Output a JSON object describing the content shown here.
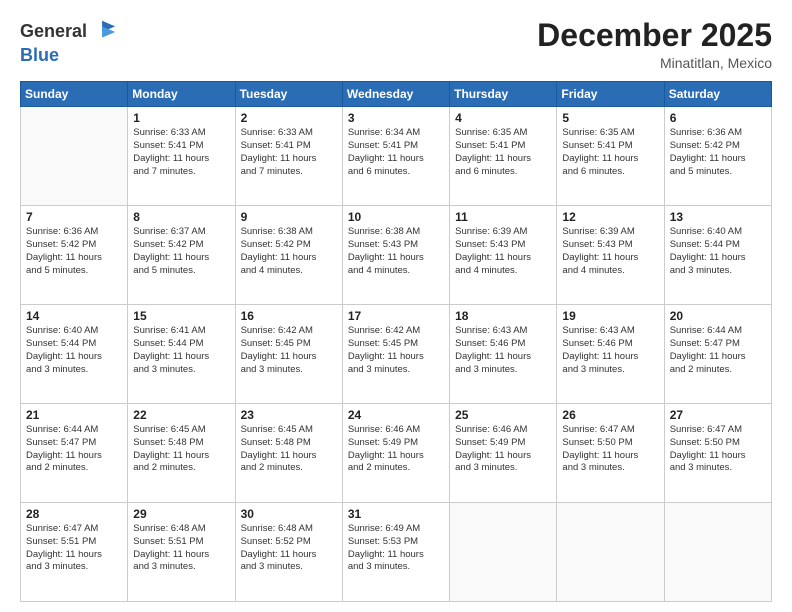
{
  "header": {
    "logo_line1": "General",
    "logo_line2": "Blue",
    "month": "December 2025",
    "location": "Minatitlan, Mexico"
  },
  "weekdays": [
    "Sunday",
    "Monday",
    "Tuesday",
    "Wednesday",
    "Thursday",
    "Friday",
    "Saturday"
  ],
  "weeks": [
    [
      {
        "day": "",
        "info": ""
      },
      {
        "day": "1",
        "info": "Sunrise: 6:33 AM\nSunset: 5:41 PM\nDaylight: 11 hours\nand 7 minutes."
      },
      {
        "day": "2",
        "info": "Sunrise: 6:33 AM\nSunset: 5:41 PM\nDaylight: 11 hours\nand 7 minutes."
      },
      {
        "day": "3",
        "info": "Sunrise: 6:34 AM\nSunset: 5:41 PM\nDaylight: 11 hours\nand 6 minutes."
      },
      {
        "day": "4",
        "info": "Sunrise: 6:35 AM\nSunset: 5:41 PM\nDaylight: 11 hours\nand 6 minutes."
      },
      {
        "day": "5",
        "info": "Sunrise: 6:35 AM\nSunset: 5:41 PM\nDaylight: 11 hours\nand 6 minutes."
      },
      {
        "day": "6",
        "info": "Sunrise: 6:36 AM\nSunset: 5:42 PM\nDaylight: 11 hours\nand 5 minutes."
      }
    ],
    [
      {
        "day": "7",
        "info": "Sunrise: 6:36 AM\nSunset: 5:42 PM\nDaylight: 11 hours\nand 5 minutes."
      },
      {
        "day": "8",
        "info": "Sunrise: 6:37 AM\nSunset: 5:42 PM\nDaylight: 11 hours\nand 5 minutes."
      },
      {
        "day": "9",
        "info": "Sunrise: 6:38 AM\nSunset: 5:42 PM\nDaylight: 11 hours\nand 4 minutes."
      },
      {
        "day": "10",
        "info": "Sunrise: 6:38 AM\nSunset: 5:43 PM\nDaylight: 11 hours\nand 4 minutes."
      },
      {
        "day": "11",
        "info": "Sunrise: 6:39 AM\nSunset: 5:43 PM\nDaylight: 11 hours\nand 4 minutes."
      },
      {
        "day": "12",
        "info": "Sunrise: 6:39 AM\nSunset: 5:43 PM\nDaylight: 11 hours\nand 4 minutes."
      },
      {
        "day": "13",
        "info": "Sunrise: 6:40 AM\nSunset: 5:44 PM\nDaylight: 11 hours\nand 3 minutes."
      }
    ],
    [
      {
        "day": "14",
        "info": "Sunrise: 6:40 AM\nSunset: 5:44 PM\nDaylight: 11 hours\nand 3 minutes."
      },
      {
        "day": "15",
        "info": "Sunrise: 6:41 AM\nSunset: 5:44 PM\nDaylight: 11 hours\nand 3 minutes."
      },
      {
        "day": "16",
        "info": "Sunrise: 6:42 AM\nSunset: 5:45 PM\nDaylight: 11 hours\nand 3 minutes."
      },
      {
        "day": "17",
        "info": "Sunrise: 6:42 AM\nSunset: 5:45 PM\nDaylight: 11 hours\nand 3 minutes."
      },
      {
        "day": "18",
        "info": "Sunrise: 6:43 AM\nSunset: 5:46 PM\nDaylight: 11 hours\nand 3 minutes."
      },
      {
        "day": "19",
        "info": "Sunrise: 6:43 AM\nSunset: 5:46 PM\nDaylight: 11 hours\nand 3 minutes."
      },
      {
        "day": "20",
        "info": "Sunrise: 6:44 AM\nSunset: 5:47 PM\nDaylight: 11 hours\nand 2 minutes."
      }
    ],
    [
      {
        "day": "21",
        "info": "Sunrise: 6:44 AM\nSunset: 5:47 PM\nDaylight: 11 hours\nand 2 minutes."
      },
      {
        "day": "22",
        "info": "Sunrise: 6:45 AM\nSunset: 5:48 PM\nDaylight: 11 hours\nand 2 minutes."
      },
      {
        "day": "23",
        "info": "Sunrise: 6:45 AM\nSunset: 5:48 PM\nDaylight: 11 hours\nand 2 minutes."
      },
      {
        "day": "24",
        "info": "Sunrise: 6:46 AM\nSunset: 5:49 PM\nDaylight: 11 hours\nand 2 minutes."
      },
      {
        "day": "25",
        "info": "Sunrise: 6:46 AM\nSunset: 5:49 PM\nDaylight: 11 hours\nand 3 minutes."
      },
      {
        "day": "26",
        "info": "Sunrise: 6:47 AM\nSunset: 5:50 PM\nDaylight: 11 hours\nand 3 minutes."
      },
      {
        "day": "27",
        "info": "Sunrise: 6:47 AM\nSunset: 5:50 PM\nDaylight: 11 hours\nand 3 minutes."
      }
    ],
    [
      {
        "day": "28",
        "info": "Sunrise: 6:47 AM\nSunset: 5:51 PM\nDaylight: 11 hours\nand 3 minutes."
      },
      {
        "day": "29",
        "info": "Sunrise: 6:48 AM\nSunset: 5:51 PM\nDaylight: 11 hours\nand 3 minutes."
      },
      {
        "day": "30",
        "info": "Sunrise: 6:48 AM\nSunset: 5:52 PM\nDaylight: 11 hours\nand 3 minutes."
      },
      {
        "day": "31",
        "info": "Sunrise: 6:49 AM\nSunset: 5:53 PM\nDaylight: 11 hours\nand 3 minutes."
      },
      {
        "day": "",
        "info": ""
      },
      {
        "day": "",
        "info": ""
      },
      {
        "day": "",
        "info": ""
      }
    ]
  ]
}
